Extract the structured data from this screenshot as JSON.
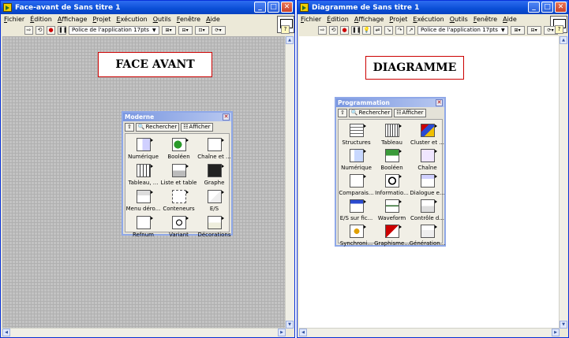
{
  "left_window": {
    "title": "Face-avant de Sans titre 1",
    "menu": [
      "Fichier",
      "Édition",
      "Affichage",
      "Projet",
      "Exécution",
      "Outils",
      "Fenêtre",
      "Aide"
    ],
    "font_select": "Police de l'application 17pts",
    "label": "FACE AVANT",
    "palette": {
      "title": "Moderne",
      "search_label": "Rechercher",
      "show_label": "Afficher",
      "items": [
        {
          "label": "Numérique",
          "icon": "numeric-icon"
        },
        {
          "label": "Booléen",
          "icon": "boolean-icon"
        },
        {
          "label": "Chaîne et ...",
          "icon": "string-icon"
        },
        {
          "label": "Tableau, ...",
          "icon": "array-icon"
        },
        {
          "label": "Liste et table",
          "icon": "list-table-icon"
        },
        {
          "label": "Graphe",
          "icon": "graph-icon"
        },
        {
          "label": "Menu déro...",
          "icon": "ring-menu-icon"
        },
        {
          "label": "Conteneurs",
          "icon": "containers-icon"
        },
        {
          "label": "E/S",
          "icon": "io-icon"
        },
        {
          "label": "Refnum",
          "icon": "refnum-icon"
        },
        {
          "label": "Variant",
          "icon": "variant-icon"
        },
        {
          "label": "Décorations",
          "icon": "decorations-icon"
        }
      ]
    }
  },
  "right_window": {
    "title": "Diagramme de Sans titre 1",
    "menu": [
      "Fichier",
      "Édition",
      "Affichage",
      "Projet",
      "Exécution",
      "Outils",
      "Fenêtre",
      "Aide"
    ],
    "font_select": "Police de l'application 17pts",
    "label": "DIAGRAMME",
    "palette": {
      "title": "Programmation",
      "search_label": "Rechercher",
      "show_label": "Afficher",
      "items": [
        {
          "label": "Structures",
          "icon": "structures-icon"
        },
        {
          "label": "Tableau",
          "icon": "array-icon"
        },
        {
          "label": "Cluster et ...",
          "icon": "cluster-icon"
        },
        {
          "label": "Numérique",
          "icon": "numeric-icon"
        },
        {
          "label": "Booléen",
          "icon": "boolean-icon"
        },
        {
          "label": "Chaîne",
          "icon": "string-icon"
        },
        {
          "label": "Comparais...",
          "icon": "comparison-icon"
        },
        {
          "label": "Informatio...",
          "icon": "timing-icon"
        },
        {
          "label": "Dialogue e...",
          "icon": "dialog-icon"
        },
        {
          "label": "E/S sur fic...",
          "icon": "file-io-icon"
        },
        {
          "label": "Waveform",
          "icon": "waveform-icon"
        },
        {
          "label": "Contrôle d...",
          "icon": "app-control-icon"
        },
        {
          "label": "Synchroni...",
          "icon": "synchronization-icon"
        },
        {
          "label": "Graphisme...",
          "icon": "graphics-icon"
        },
        {
          "label": "Génération...",
          "icon": "report-generation-icon"
        }
      ]
    }
  }
}
